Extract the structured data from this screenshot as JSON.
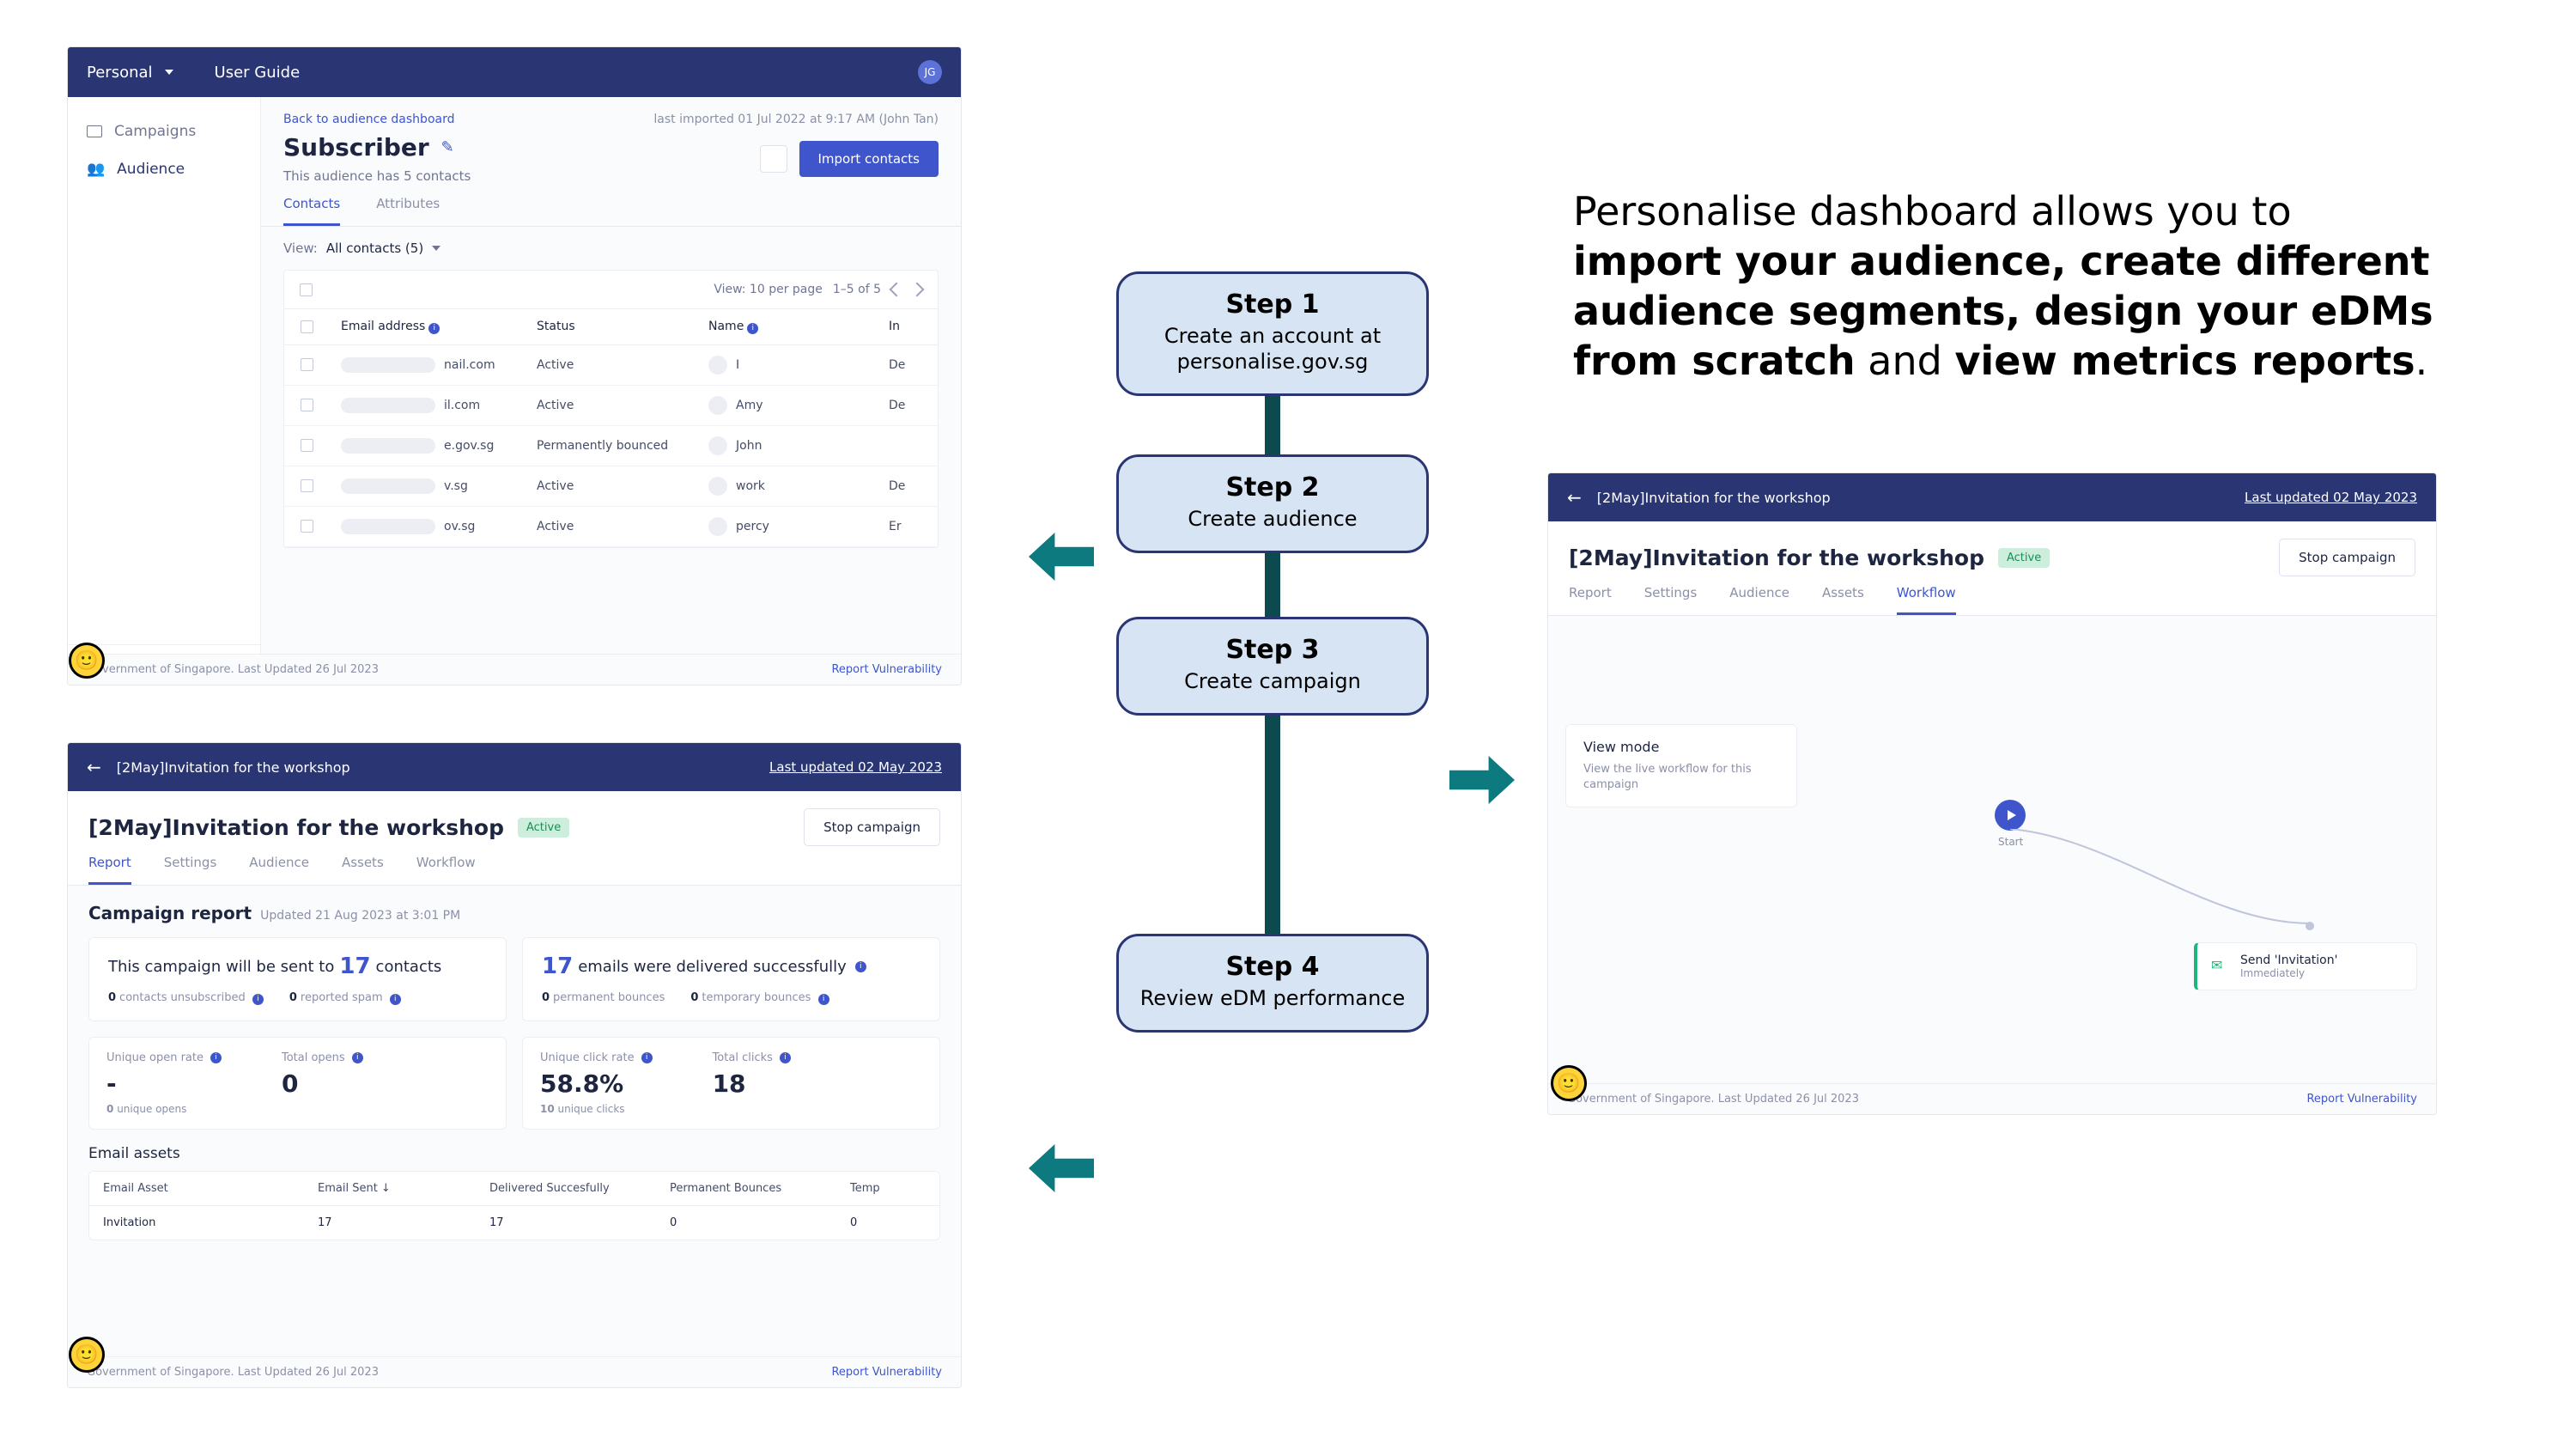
{
  "headline": {
    "plain1": "Personalise dashboard allows you to ",
    "bold1": "import your audience, create different audience segments, design your eDMs from scratch",
    "plain2": " and ",
    "bold2": "view metrics reports",
    "plain3": "."
  },
  "steps": [
    {
      "title": "Step 1",
      "text": "Create an account at personalise.gov.sg"
    },
    {
      "title": "Step 2",
      "text": "Create audience"
    },
    {
      "title": "Step 3",
      "text": "Create campaign"
    },
    {
      "title": "Step 4",
      "text": "Review eDM performance"
    }
  ],
  "shot1": {
    "topbar": {
      "workspace": "Personal",
      "guide": "User Guide",
      "avatar": "JG"
    },
    "sidebar": {
      "campaigns": "Campaigns",
      "audience": "Audience",
      "toggle": "Toggle sidebar"
    },
    "back": "Back to audience dashboard",
    "imported": "last imported 01 Jul 2022 at 9:17 AM (John Tan)",
    "title": "Subscriber",
    "subtitle": "This audience has 5 contacts",
    "import": "Import contacts",
    "tabs": {
      "contacts": "Contacts",
      "attributes": "Attributes"
    },
    "view": {
      "label": "View:",
      "value": "All contacts (5)"
    },
    "tctrl": {
      "perpage": "View: 10 per page",
      "range": "1–5 of 5"
    },
    "thead": {
      "email": "Email address",
      "status": "Status",
      "name": "Name",
      "in": "In"
    },
    "rows": [
      {
        "emailEnd": "nail.com",
        "status": "Active",
        "name": "I",
        "in": "De"
      },
      {
        "emailEnd": "il.com",
        "status": "Active",
        "name": "Amy",
        "in": "De"
      },
      {
        "emailEnd": "e.gov.sg",
        "status": "Permanently bounced",
        "name": "John",
        "in": ""
      },
      {
        "emailEnd": "v.sg",
        "status": "Active",
        "name": "work",
        "in": "De"
      },
      {
        "emailEnd": "ov.sg",
        "status": "Active",
        "name": "percy",
        "in": "Er"
      }
    ],
    "footer": {
      "left": "Government of Singapore. Last Updated 26 Jul 2023",
      "right": "Report Vulnerability"
    }
  },
  "shot2": {
    "bar": {
      "title": "[2May]Invitation for the workshop",
      "updated": "Last updated 02 May 2023"
    },
    "title": "[2May]Invitation for the workshop",
    "badge": "Active",
    "stop": "Stop campaign",
    "tabs": [
      "Report",
      "Settings",
      "Audience",
      "Assets",
      "Workflow"
    ],
    "activeTab": 0,
    "report": {
      "header": "Campaign report",
      "updated": "Updated 21 Aug 2023 at 3:01 PM"
    },
    "card1": {
      "pre": "This campaign will be sent to ",
      "num": "17",
      "post": " contacts",
      "unsub_n": "0",
      "unsub": "contacts unsubscribed",
      "spam_n": "0",
      "spam": "reported spam"
    },
    "card2": {
      "num": "17",
      "post": " emails were delivered successfully",
      "perm_n": "0",
      "perm": "permanent bounces",
      "temp_n": "0",
      "temp": "temporary bounces"
    },
    "m": {
      "open_l": "Unique open rate",
      "open_v": "-",
      "open_s_n": "0",
      "open_s": "unique opens",
      "topen_l": "Total opens",
      "topen_v": "0",
      "click_l": "Unique click rate",
      "click_v": "58.8%",
      "click_s_n": "10",
      "click_s": "unique clicks",
      "tclick_l": "Total clicks",
      "tclick_v": "18"
    },
    "assets": {
      "title": "Email assets",
      "headers": [
        "Email Asset",
        "Email Sent  ↓",
        "Delivered Succesfully",
        "Permanent Bounces",
        "Temp"
      ],
      "row": [
        "Invitation",
        "17",
        "17",
        "0",
        "0"
      ]
    },
    "footer": {
      "left": "Government of Singapore. Last Updated 26 Jul 2023",
      "right": "Report Vulnerability"
    }
  },
  "shot3": {
    "bar": {
      "title": "[2May]Invitation for the workshop",
      "updated": "Last updated 02 May 2023"
    },
    "title": "[2May]Invitation for the workshop",
    "badge": "Active",
    "stop": "Stop campaign",
    "tabs": [
      "Report",
      "Settings",
      "Audience",
      "Assets",
      "Workflow"
    ],
    "activeTab": 4,
    "viewmode": {
      "title": "View mode",
      "text": "View the live workflow for this campaign"
    },
    "start": "Start",
    "send": {
      "title": "Send 'Invitation'",
      "sub": "Immediately"
    },
    "footer": {
      "left": "Government of Singapore. Last Updated 26 Jul 2023",
      "right": "Report Vulnerability"
    }
  }
}
